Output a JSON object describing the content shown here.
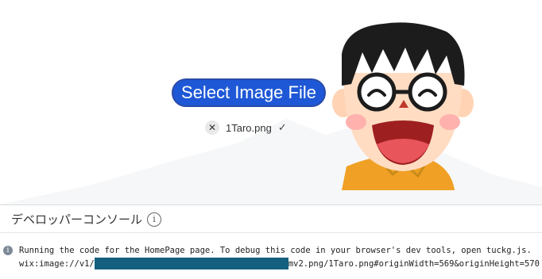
{
  "upload": {
    "button_label": "Select Image File",
    "file_name": "1Taro.png",
    "remove_glyph": "✕",
    "check_glyph": "✓"
  },
  "console": {
    "title": "デベロッパーコンソール",
    "info_glyph": "i",
    "log_icon_glyph": "i",
    "line1": "Running the code for the HomePage page. To debug this code in your browser's dev tools, open tuckg.js.",
    "line2_prefix": "wix:image://v1/",
    "line2_suffix": "mv2.png/1Taro.png#originWidth=569&originHeight=570"
  },
  "colors": {
    "button_bg": "#1e58d6",
    "redaction": "#16607f"
  },
  "icons": {
    "remove": "close-icon",
    "status": "checkmark-icon",
    "info": "info-icon"
  }
}
